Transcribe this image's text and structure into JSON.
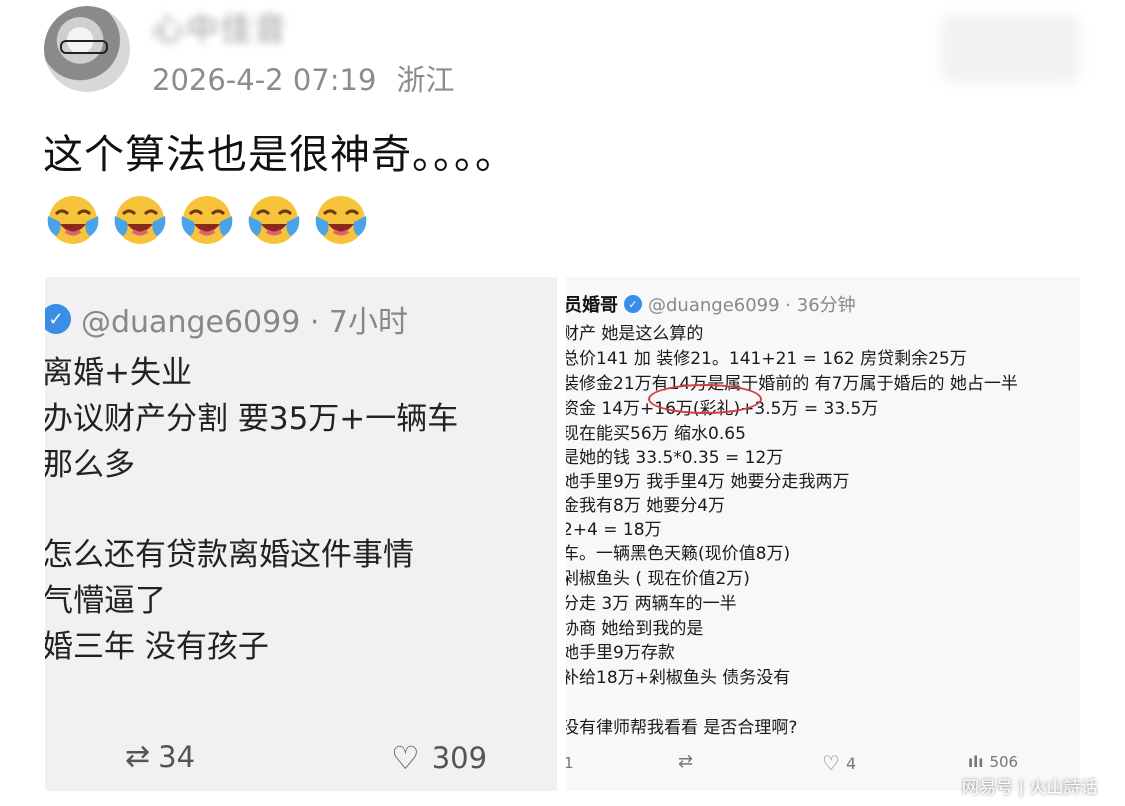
{
  "post": {
    "author_name": "心中佳音",
    "date": "2026-4-2 07:19",
    "location": "浙江",
    "text": "这个算法也是很神奇。。。。",
    "emoji_icon": "laughing-crying-face-icon",
    "emoji_count": 5
  },
  "left_image": {
    "handle": "@duange6099 · 7小时",
    "lines": [
      "离婚+失业",
      "办议财产分割 要35万+一辆车",
      "那么多",
      "",
      "  怎么还有贷款离婚这件事情",
      "气懵逼了",
      "婚三年 没有孩子"
    ],
    "retweets": "34",
    "likes": "309"
  },
  "right_image": {
    "display_name": "员婚哥",
    "handle": "@duange6099 · 36分钟",
    "lines": [
      "财产 她是这么算的",
      "总价141 加 装修21。141+21 = 162 房贷剩余25万",
      "装修金21万有14万是属于婚前的 有7万属于婚后的 她占一半",
      "资金 14万+16万(彩礼)+3.5万 = 33.5万",
      "现在能买56万 缩水0.65",
      "是她的钱 33.5*0.35 = 12万",
      "她手里9万 我手里4万 她要分走我两万",
      "金我有8万 她要分4万",
      "2+4 = 18万",
      "车。一辆黑色天籁(现价值8万)",
      "剁椒鱼头 ( 现在价值2万)",
      "分走 3万 两辆车的一半",
      "  协商 她给到我的是",
      "她手里9万存款",
      "补给18万+剁椒鱼头 债务没有",
      "",
      "没有律师帮我看看 是否合理啊?"
    ],
    "replies": "1",
    "likes": "4",
    "views": "506"
  },
  "watermark": "网易号 | 火山詩话"
}
